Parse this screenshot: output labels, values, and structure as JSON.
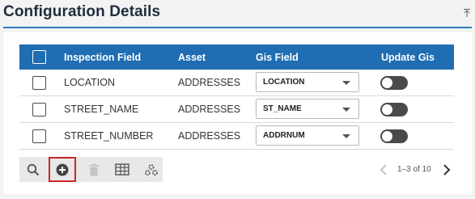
{
  "panel": {
    "title": "Configuration Details"
  },
  "table": {
    "columns": {
      "inspection_field": "Inspection Field",
      "asset": "Asset",
      "gis_field": "Gis Field",
      "update_gis": "Update Gis"
    },
    "rows": [
      {
        "inspection_field": "LOCATION",
        "asset": "ADDRESSES",
        "gis_field": "LOCATION",
        "update_gis": false
      },
      {
        "inspection_field": "STREET_NAME",
        "asset": "ADDRESSES",
        "gis_field": "ST_NAME",
        "update_gis": false
      },
      {
        "inspection_field": "STREET_NUMBER",
        "asset": "ADDRESSES",
        "gis_field": "ADDRNUM",
        "update_gis": false
      }
    ]
  },
  "toolbar": {
    "buttons": [
      "search-icon",
      "add-circle-icon",
      "trash-icon",
      "table-grid-icon",
      "settings-cogs-icon"
    ],
    "active": "add-circle-icon"
  },
  "pagination": {
    "label": "1–3 of 10"
  },
  "colors": {
    "header_blue": "#1f6db3",
    "accent_rule": "#2f7bbf",
    "toggle_off": "#4a4a4a",
    "active_outline": "#c62828"
  }
}
